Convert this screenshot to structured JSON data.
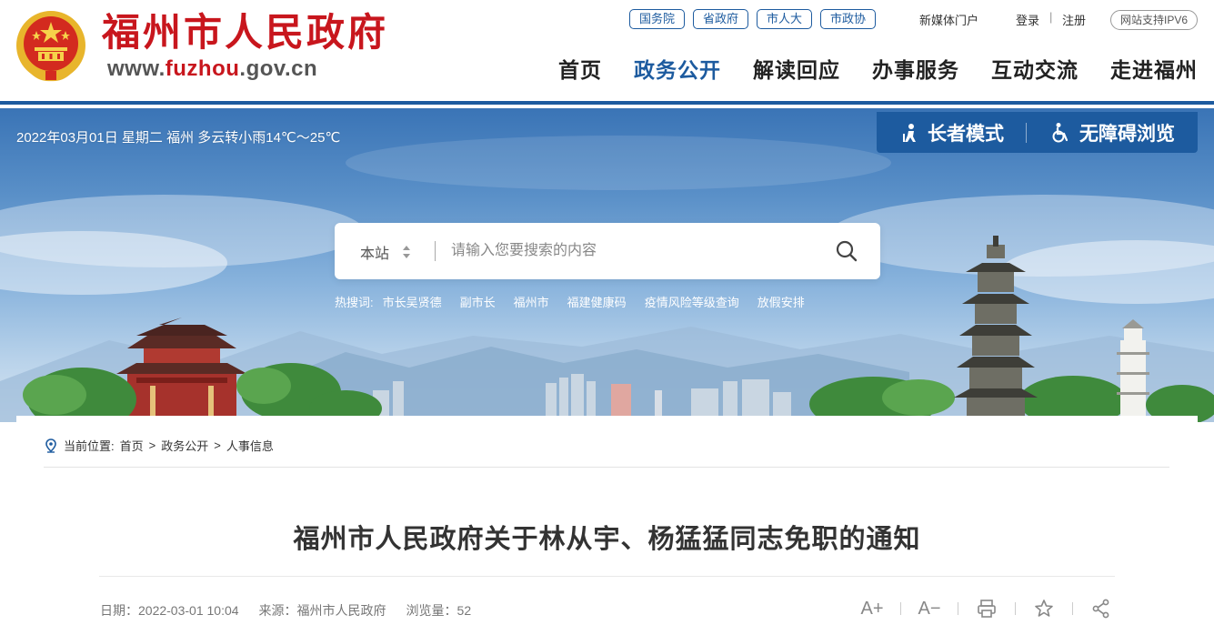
{
  "header": {
    "site_title": "福州市人民政府",
    "site_url_prefix": "www.",
    "site_url_highlight": "fuzhou",
    "site_url_suffix": ".gov.cn",
    "top_links": [
      "国务院",
      "省政府",
      "市人大",
      "市政协"
    ],
    "new_media": "新媒体门户",
    "login": "登录",
    "separator": "|",
    "register": "注册",
    "ipv6_badge": "网站支持IPV6",
    "nav": [
      {
        "label": "首页",
        "active": false
      },
      {
        "label": "政务公开",
        "active": true
      },
      {
        "label": "解读回应",
        "active": false
      },
      {
        "label": "办事服务",
        "active": false
      },
      {
        "label": "互动交流",
        "active": false
      },
      {
        "label": "走进福州",
        "active": false
      }
    ]
  },
  "banner": {
    "date_weather": "2022年03月01日 星期二 福州 多云转小雨14℃～25℃",
    "elder_mode": "长者模式",
    "accessible": "无障碍浏览"
  },
  "search": {
    "scope": "本站",
    "placeholder": "请输入您要搜索的内容",
    "hot_label": "热搜词:",
    "hot_words": [
      "市长吴贤德",
      "副市长",
      "福州市",
      "福建健康码",
      "疫情风险等级查询",
      "放假安排"
    ]
  },
  "breadcrumb": {
    "label": "当前位置:",
    "items": [
      "首页",
      "政务公开",
      "人事信息"
    ],
    "sep": ">"
  },
  "article": {
    "title": "福州市人民政府关于林从宇、杨猛猛同志免职的通知",
    "date": "日期：2022-03-01 10:04",
    "source": "来源：福州市人民政府",
    "views": "浏览量：52",
    "font_increase": "A+",
    "font_decrease": "A−"
  },
  "colors": {
    "brand_red": "#c8161d",
    "brand_blue": "#1d5b9f"
  }
}
